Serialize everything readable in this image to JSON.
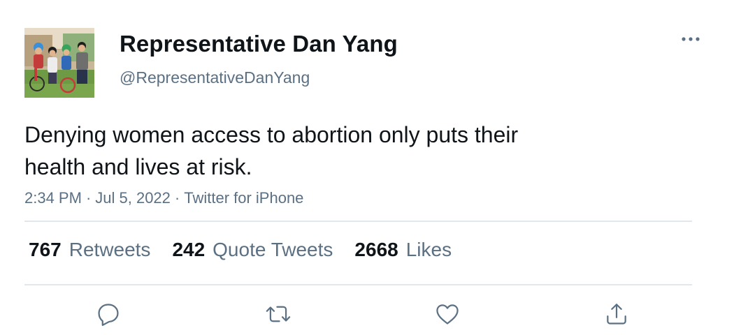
{
  "author": {
    "display_name": "Representative Dan Yang",
    "handle": "@RepresentativeDanYang",
    "avatar_icon": "family-photo-avatar"
  },
  "tweet": {
    "text_lines": [
      "Denying women access to abortion only puts their",
      "health and lives at risk."
    ],
    "time": "2:34 PM",
    "date": "Jul 5, 2022",
    "source": "Twitter for iPhone",
    "separator": "·"
  },
  "stats": {
    "retweets": {
      "count": "767",
      "label": "Retweets"
    },
    "quote_tweets": {
      "count": "242",
      "label": "Quote Tweets"
    },
    "likes": {
      "count": "2668",
      "label": "Likes"
    }
  },
  "actions": {
    "reply_icon": "reply-icon",
    "retweet_icon": "retweet-icon",
    "like_icon": "heart-icon",
    "share_icon": "share-icon"
  },
  "colors": {
    "text": "#0f1419",
    "secondary": "#5b7083",
    "divider": "#e1e8ed",
    "icon": "#5b7083"
  }
}
